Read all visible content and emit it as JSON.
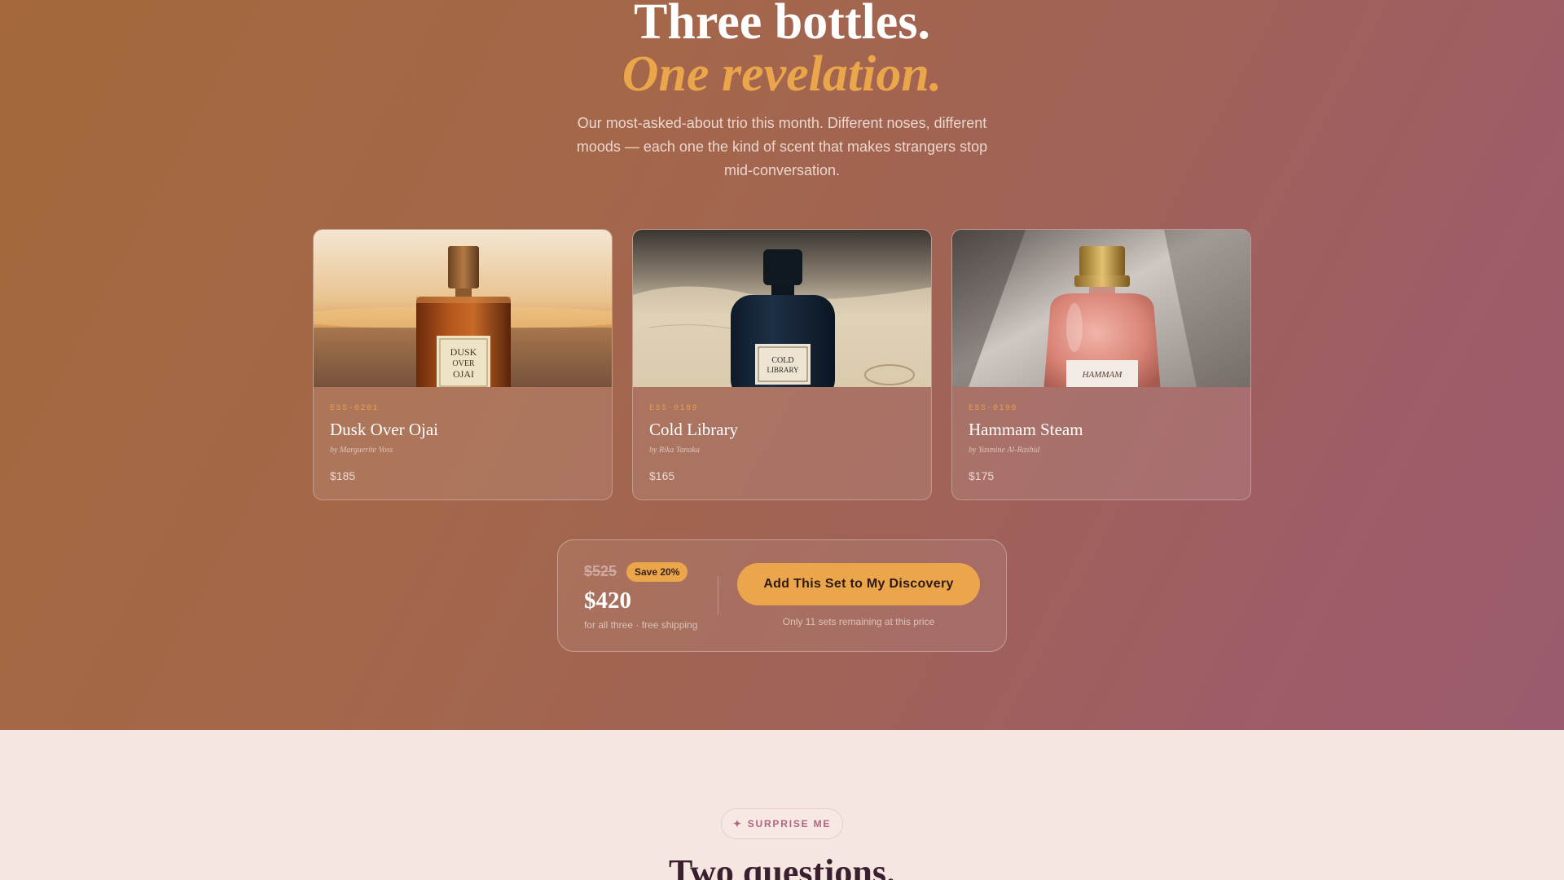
{
  "hero": {
    "title": "Three bottles.",
    "subtitle": "One revelation.",
    "description": "Our most-asked-about trio this month. Different noses, different moods — each one the kind of scent that makes strangers stop mid-conversation."
  },
  "products": [
    {
      "sku": "ESS-0201",
      "name": "Dusk Over Ojai",
      "by": "by Marguerite Voss",
      "price": "$185",
      "label": "DUSK OVER OJAI",
      "image": "amber-perfume-bottle-at-sunset"
    },
    {
      "sku": "ESS-0189",
      "name": "Cold Library",
      "by": "by Rika Tanaka",
      "price": "$165",
      "label": "COLD LIBRARY",
      "image": "navy-perfume-bottle-on-parchment"
    },
    {
      "sku": "ESS-0196",
      "name": "Hammam Steam",
      "by": "by Yasmine Al-Rashid",
      "price": "$175",
      "label": "HAMMAM STEAM",
      "image": "rose-perfume-bottle-gold-cap"
    }
  ],
  "offer": {
    "old_price": "$525",
    "save_badge": "Save 20%",
    "new_price": "$420",
    "note": "for all three · free shipping",
    "cta_label": "Add This Set to My Discovery",
    "cta_note": "Only 11 sets remaining at this price"
  },
  "section2": {
    "badge_icon": "✦",
    "badge_label": "SURPRISE ME",
    "title": "Two questions."
  },
  "colors": {
    "accent": "#eba54a",
    "hero_gradient_start": "#a4683c",
    "hero_gradient_end": "#9a5b6e",
    "section_bg": "#f5e6e1"
  }
}
